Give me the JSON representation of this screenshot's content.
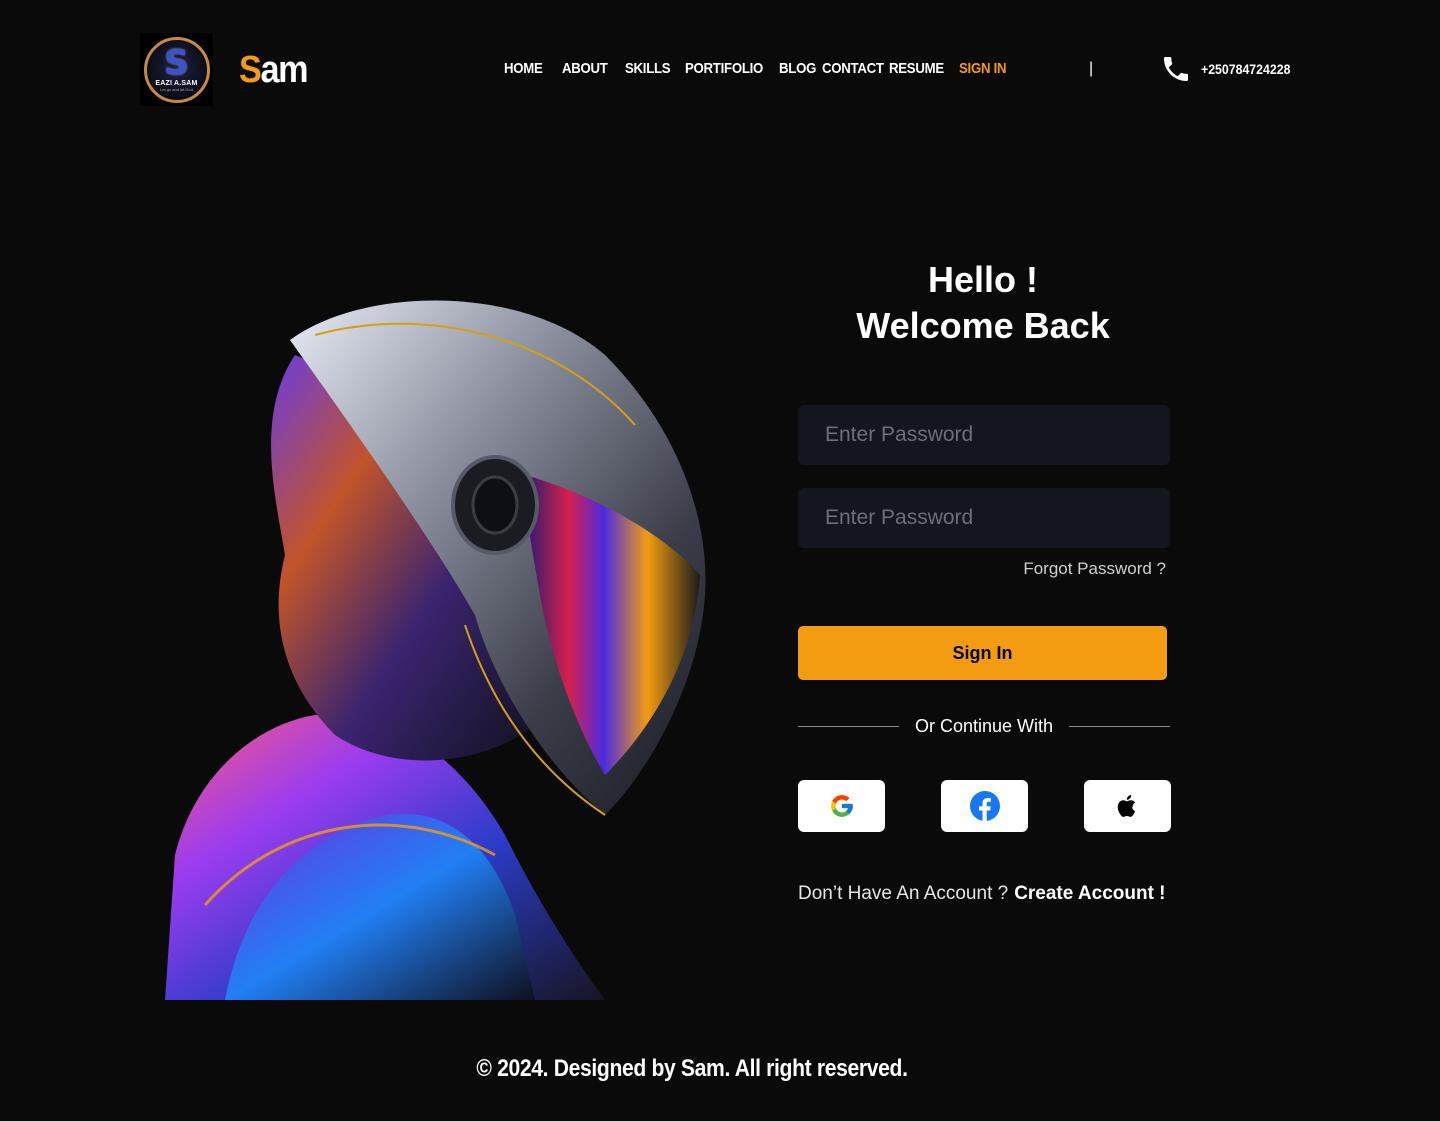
{
  "header": {
    "logo": {
      "letter": "S",
      "text": "EAZI A.SAM",
      "tagline": "Let go and let God"
    },
    "brand": {
      "first": "S",
      "rest": "am"
    },
    "nav": [
      {
        "label": "HOME"
      },
      {
        "label": "ABOUT"
      },
      {
        "label": "SKILLS"
      },
      {
        "label": "PORTIFOLIO"
      },
      {
        "label": "BLOG"
      },
      {
        "label": "CONTACT"
      },
      {
        "label": "RESUME"
      },
      {
        "label": "SIGN IN",
        "active": true
      }
    ],
    "separator": "|",
    "phone": "+250784724228",
    "phone_icon": "phone-icon"
  },
  "form": {
    "greeting_line1": "Hello !",
    "greeting_line2": "Welcome Back",
    "field1_placeholder": "Enter Password",
    "field2_placeholder": "Enter Password",
    "forgot_label": "Forgot Password ?",
    "signin_label": "Sign In",
    "divider_text": "Or Continue With",
    "social": [
      "google-icon",
      "facebook-icon",
      "apple-icon"
    ],
    "signup_question": "Don’t Have An Account ?",
    "signup_link": "Create Account !"
  },
  "footer": {
    "text": "© 2024. Designed by Sam. All right reserved."
  },
  "colors": {
    "accent": "#f39c12",
    "background": "#0a0a0a",
    "field_bg": "#13161d"
  }
}
